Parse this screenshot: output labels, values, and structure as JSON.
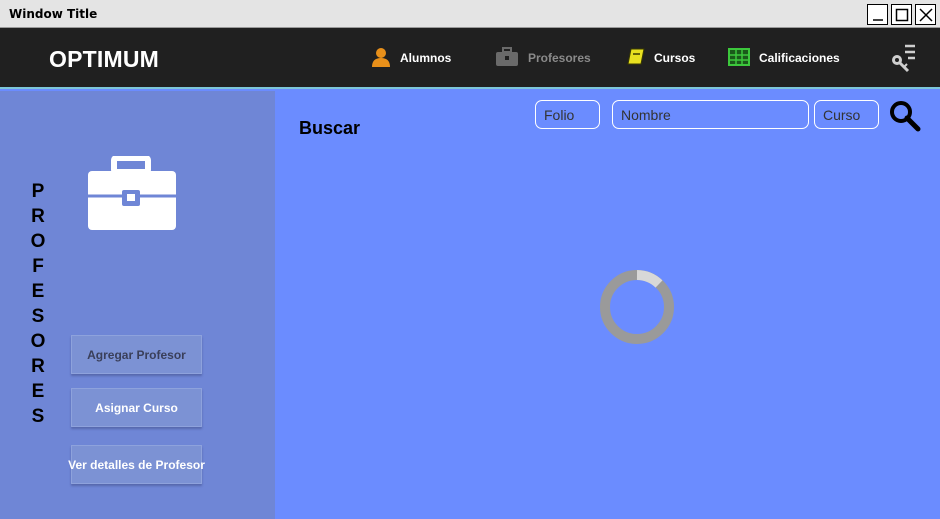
{
  "window": {
    "title": "Window Title"
  },
  "navbar": {
    "brand": "OPTIMUM",
    "items": [
      {
        "label": "Alumnos",
        "icon": "user-icon",
        "color": "#e8901a"
      },
      {
        "label": "Profesores",
        "icon": "briefcase-icon",
        "color": "#8a8a8a"
      },
      {
        "label": "Cursos",
        "icon": "book-icon",
        "color": "#e8e020"
      },
      {
        "label": "Calificaciones",
        "icon": "grid-icon",
        "color": "#3cc83c"
      }
    ],
    "menu_icon": "key-menu-icon"
  },
  "sidebar": {
    "vertical_title": [
      "P",
      "R",
      "O",
      "F",
      "E",
      "S",
      "O",
      "R",
      "E",
      "S"
    ],
    "header_icon": "briefcase-icon",
    "buttons": {
      "add": "Agregar Profesor",
      "assign": "Asignar Curso",
      "details": "Ver detalles de Profesor"
    }
  },
  "main": {
    "search_label": "Buscar",
    "inputs": {
      "folio_placeholder": "Folio",
      "nombre_placeholder": "Nombre",
      "curso_placeholder": "Curso"
    },
    "search_icon": "search-icon",
    "loading_icon": "spinner-icon"
  },
  "colors": {
    "navbar_bg": "#202020",
    "sidebar_bg": "#6f86d6",
    "main_bg": "#6b8cff",
    "accent_line": "#7cc6d8"
  }
}
